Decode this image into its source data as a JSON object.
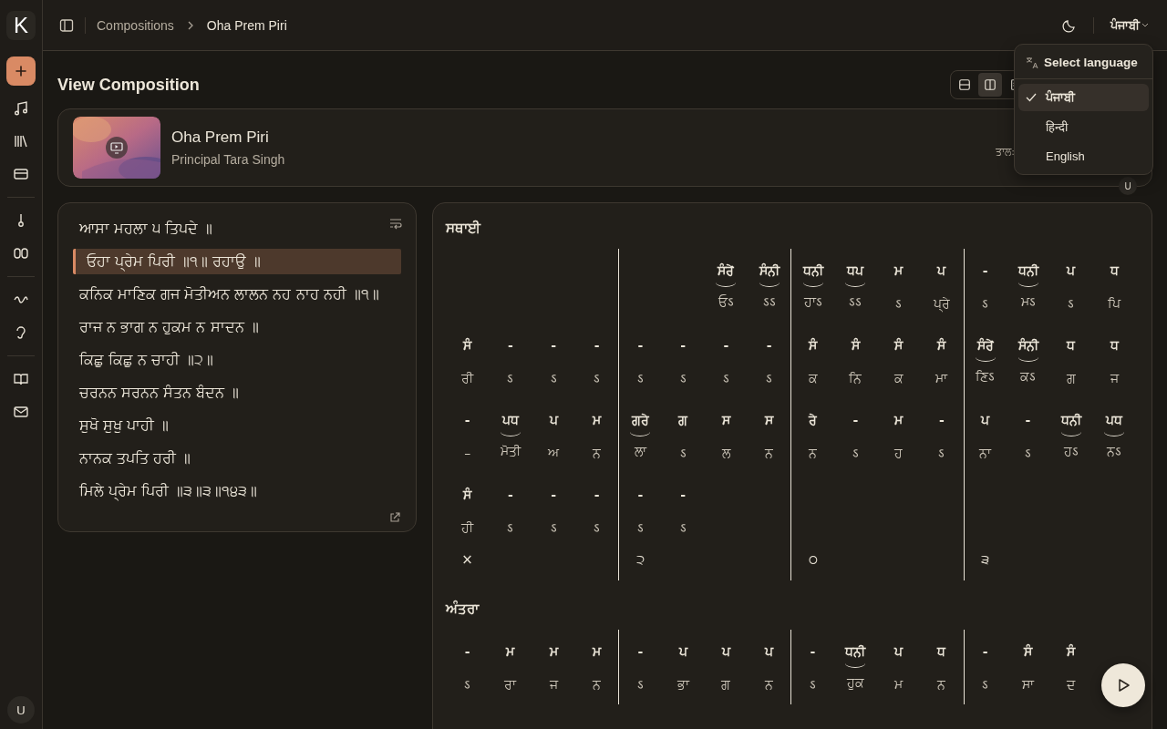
{
  "sidebar": {
    "logo": "K",
    "user_avatar": "U"
  },
  "header": {
    "breadcrumbs": [
      "Compositions",
      "Oha Prem Piri"
    ],
    "language": "ਪੰਜਾਬੀ"
  },
  "language_menu": {
    "title": "Select language",
    "options": [
      {
        "label": "ਪੰਜਾਬੀ",
        "selected": true
      },
      {
        "label": "हिन्दी",
        "selected": false
      },
      {
        "label": "English",
        "selected": false
      }
    ]
  },
  "page_title": "View Composition",
  "view_toggle": [
    {
      "kind": "rows",
      "selected": false
    },
    {
      "kind": "columns",
      "selected": true
    },
    {
      "kind": "text",
      "selected": false
    }
  ],
  "composition": {
    "title": "Oha Prem Piri",
    "artist": "Principal Tara Singh",
    "taal_label": "ਤਾਲ:",
    "badge": "U"
  },
  "lyrics": [
    {
      "text": "ਆਸਾ ਮਹਲਾ ੫ ਤਿਪਦੇ ॥",
      "selected": false
    },
    {
      "text": "ਓਹਾ ਪ੍ਰੇਮ ਪਿਰੀ ॥੧॥ ਰਹਾਉ ॥",
      "selected": true
    },
    {
      "text": "ਕਨਿਕ ਮਾਣਿਕ ਗਜ ਮੋਤੀਅਨ ਲਾਲਨ ਨਹ ਨਾਹ ਨਹੀ ॥੧॥",
      "selected": false
    },
    {
      "text": "ਰਾਜ ਨ ਭਾਗ ਨ ਹੁਕਮ ਨ ਸਾਦਨ ॥",
      "selected": false
    },
    {
      "text": "ਕਿਛੁ ਕਿਛੁ ਨ ਚਾਹੀ ॥੨॥",
      "selected": false
    },
    {
      "text": "ਚਰਨਨ ਸਰਨਨ ਸੰਤਨ ਬੰਦਨ ॥",
      "selected": false
    },
    {
      "text": "ਸੁਖੋ ਸੁਖੁ ਪਾਹੀ ॥",
      "selected": false
    },
    {
      "text": "ਨਾਨਕ ਤਪਤਿ ਹਰੀ ॥",
      "selected": false
    },
    {
      "text": "ਮਿਲੇ ਪ੍ਰੇਮ ਪਿਰੀ ॥੩॥੩॥੧੪੩॥",
      "selected": false
    }
  ],
  "notation": [
    {
      "title": "ਸਥਾਈ",
      "rows": [
        {
          "cells": [
            {
              "kind": "blank"
            },
            {
              "kind": "blank"
            },
            {
              "kind": "blank"
            },
            {
              "kind": "blank"
            },
            {
              "kind": "blank"
            },
            {
              "kind": "blank"
            },
            {
              "kind": "note",
              "swar": "ਸੰਰੇਂ",
              "bol": "ਓऽ",
              "tied": true
            },
            {
              "kind": "note",
              "swar": "ਸੰਨੀ",
              "bol": "ऽऽ",
              "tied": true
            },
            {
              "kind": "note",
              "swar": "ਧਨੀ",
              "bol": "ਹਾऽ",
              "tied": true
            },
            {
              "kind": "note",
              "swar": "ਧਪ",
              "bol": "ऽऽ",
              "tied": true
            },
            {
              "kind": "note",
              "swar": "ਮ",
              "bol": "ऽ",
              "tied": false
            },
            {
              "kind": "note",
              "swar": "ਪ",
              "bol": "ਪ੍ਰੇ",
              "tied": false
            },
            {
              "kind": "note",
              "swar": "-",
              "bol": "ऽ",
              "tied": false
            },
            {
              "kind": "note",
              "swar": "ਧਨੀ",
              "bol": "ਮऽ",
              "tied": true
            },
            {
              "kind": "note",
              "swar": "ਪ",
              "bol": "ऽ",
              "tied": false
            },
            {
              "kind": "note",
              "swar": "ਧ",
              "bol": "ਪਿ",
              "tied": false
            }
          ]
        },
        {
          "cells": [
            {
              "kind": "note",
              "swar": "ਸੰ",
              "bol": "ਰੀ",
              "tied": false
            },
            {
              "kind": "note",
              "swar": "-",
              "bol": "ऽ",
              "tied": false
            },
            {
              "kind": "note",
              "swar": "-",
              "bol": "ऽ",
              "tied": false
            },
            {
              "kind": "note",
              "swar": "-",
              "bol": "ऽ",
              "tied": false
            },
            {
              "kind": "note",
              "swar": "-",
              "bol": "ऽ",
              "tied": false
            },
            {
              "kind": "note",
              "swar": "-",
              "bol": "ऽ",
              "tied": false
            },
            {
              "kind": "note",
              "swar": "-",
              "bol": "ऽ",
              "tied": false
            },
            {
              "kind": "note",
              "swar": "-",
              "bol": "ऽ",
              "tied": false
            },
            {
              "kind": "note",
              "swar": "ਸੰ",
              "bol": "ਕ",
              "tied": false
            },
            {
              "kind": "note",
              "swar": "ਸੰ",
              "bol": "ਨਿ",
              "tied": false
            },
            {
              "kind": "note",
              "swar": "ਸੰ",
              "bol": "ਕ",
              "tied": false
            },
            {
              "kind": "note",
              "swar": "ਸੰ",
              "bol": "ਮਾ",
              "tied": false
            },
            {
              "kind": "note",
              "swar": "ਸੰਰੇਂ",
              "bol": "ਣਿऽ",
              "tied": true
            },
            {
              "kind": "note",
              "swar": "ਸੰਨੀ",
              "bol": "ਕऽ",
              "tied": true
            },
            {
              "kind": "note",
              "swar": "ਧ",
              "bol": "ਗ",
              "tied": false
            },
            {
              "kind": "note",
              "swar": "ਧ",
              "bol": "ਜ",
              "tied": false
            }
          ]
        },
        {
          "cells": [
            {
              "kind": "note",
              "swar": "-",
              "bol": "–",
              "tied": false
            },
            {
              "kind": "note",
              "swar": "ਪਧ",
              "bol": "ਮੋਤੀ",
              "tied": true
            },
            {
              "kind": "note",
              "swar": "ਪ",
              "bol": "ਅ",
              "tied": false
            },
            {
              "kind": "note",
              "swar": "ਮ",
              "bol": "ਨ",
              "tied": false
            },
            {
              "kind": "note",
              "swar": "ਗਰੇ",
              "bol": "ਲਾ",
              "tied": true
            },
            {
              "kind": "note",
              "swar": "ਗ",
              "bol": "ऽ",
              "tied": false
            },
            {
              "kind": "note",
              "swar": "ਸ",
              "bol": "ਲ",
              "tied": false
            },
            {
              "kind": "note",
              "swar": "ਸ",
              "bol": "ਨ",
              "tied": false
            },
            {
              "kind": "note",
              "swar": "ਰੇ",
              "bol": "ਨ",
              "tied": false
            },
            {
              "kind": "note",
              "swar": "-",
              "bol": "ऽ",
              "tied": false
            },
            {
              "kind": "note",
              "swar": "ਮ",
              "bol": "ਹ",
              "tied": false
            },
            {
              "kind": "note",
              "swar": "-",
              "bol": "ऽ",
              "tied": false
            },
            {
              "kind": "note",
              "swar": "ਪ",
              "bol": "ਨਾ",
              "tied": false
            },
            {
              "kind": "note",
              "swar": "-",
              "bol": "ऽ",
              "tied": false
            },
            {
              "kind": "note",
              "swar": "ਧਨੀ",
              "bol": "ਹऽ",
              "tied": true
            },
            {
              "kind": "note",
              "swar": "ਪਧ",
              "bol": "ਨऽ",
              "tied": true
            }
          ]
        },
        {
          "cells": [
            {
              "kind": "note",
              "swar": "ਸੰ",
              "bol": "ਹੀ",
              "tied": false
            },
            {
              "kind": "note",
              "swar": "-",
              "bol": "ऽ",
              "tied": false
            },
            {
              "kind": "note",
              "swar": "-",
              "bol": "ऽ",
              "tied": false
            },
            {
              "kind": "note",
              "swar": "-",
              "bol": "ऽ",
              "tied": false
            },
            {
              "kind": "note",
              "swar": "-",
              "bol": "ऽ",
              "tied": false
            },
            {
              "kind": "note",
              "swar": "-",
              "bol": "ऽ",
              "tied": false
            }
          ]
        }
      ],
      "taal_marks": [
        "×",
        "੨",
        "੦",
        "੩"
      ]
    },
    {
      "title": "ਅੰਤਰਾ",
      "rows": [
        {
          "cells": [
            {
              "kind": "note",
              "swar": "-",
              "bol": "ऽ",
              "tied": false
            },
            {
              "kind": "note",
              "swar": "ਮ",
              "bol": "ਰਾ",
              "tied": false
            },
            {
              "kind": "note",
              "swar": "ਮ",
              "bol": "ਜ",
              "tied": false
            },
            {
              "kind": "note",
              "swar": "ਮ",
              "bol": "ਨ",
              "tied": false
            },
            {
              "kind": "note",
              "swar": "-",
              "bol": "ऽ",
              "tied": false
            },
            {
              "kind": "note",
              "swar": "ਪ",
              "bol": "ਭਾ",
              "tied": false
            },
            {
              "kind": "note",
              "swar": "ਪ",
              "bol": "ਗ",
              "tied": false
            },
            {
              "kind": "note",
              "swar": "ਪ",
              "bol": "ਨ",
              "tied": false
            },
            {
              "kind": "note",
              "swar": "-",
              "bol": "ऽ",
              "tied": false
            },
            {
              "kind": "note",
              "swar": "ਧਨੀ",
              "bol": "ਹੁਕ",
              "tied": true
            },
            {
              "kind": "note",
              "swar": "ਪ",
              "bol": "ਮ",
              "tied": false
            },
            {
              "kind": "note",
              "swar": "ਧ",
              "bol": "ਨ",
              "tied": false
            },
            {
              "kind": "note",
              "swar": "-",
              "bol": "ऽ",
              "tied": false
            },
            {
              "kind": "note",
              "swar": "ਸੰ",
              "bol": "ਸਾ",
              "tied": false
            },
            {
              "kind": "note",
              "swar": "ਸੰ",
              "bol": "ਦ",
              "tied": false
            }
          ]
        }
      ]
    }
  ]
}
